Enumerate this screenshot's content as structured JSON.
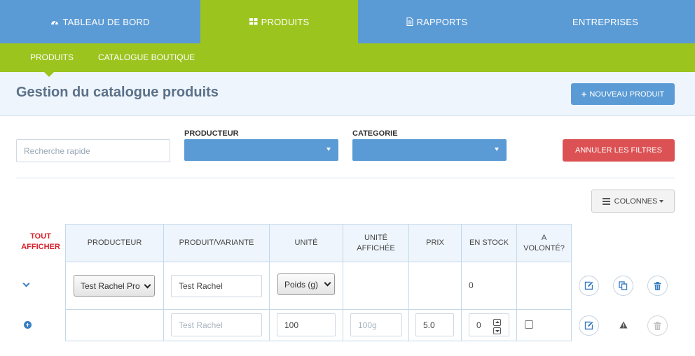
{
  "topnav": [
    {
      "label": "TABLEAU DE BORD",
      "icon": "dashboard-icon",
      "active": false
    },
    {
      "label": "PRODUITS",
      "icon": "grid-icon",
      "active": true
    },
    {
      "label": "RAPPORTS",
      "icon": "file-icon",
      "active": false
    },
    {
      "label": "ENTREPRISES",
      "icon": "",
      "active": false
    }
  ],
  "subnav": [
    "PRODUITS",
    "CATALOGUE BOUTIQUE"
  ],
  "page": {
    "title": "Gestion du catalogue produits",
    "new_button": "NOUVEAU PRODUIT"
  },
  "filters": {
    "search_placeholder": "Recherche rapide",
    "producer_label": "PRODUCTEUR",
    "category_label": "CATEGORIE",
    "cancel_button": "ANNULER LES FILTRES",
    "columns_button": "COLONNES"
  },
  "table": {
    "show_all_line1": "TOUT",
    "show_all_line2": "AFFICHER",
    "headers": [
      "PRODUCTEUR",
      "PRODUIT/VARIANTE",
      "UNITÉ",
      "UNITÉ AFFICHÉE",
      "PRIX",
      "EN STOCK",
      "A VOLONTÉ?"
    ],
    "header_lines": {
      "unite_aff_1": "UNITÉ",
      "unite_aff_2": "AFFICHÉE",
      "volonte_1": "A",
      "volonte_2": "VOLONTÉ?"
    },
    "row1": {
      "producer": "Test Rachel Pro",
      "product": "Test Rachel",
      "unit": "Poids (g)",
      "stock": "0"
    },
    "row2": {
      "product_placeholder": "Test Rachel",
      "unit_value": "100",
      "displayed_unit_placeholder": "100g",
      "price": "5.0",
      "stock": "0",
      "on_demand": false
    }
  },
  "colors": {
    "nav_blue": "#5b9bd5",
    "nav_green": "#9cc41f",
    "danger": "#dc5153",
    "show_all": "#d8202a"
  }
}
